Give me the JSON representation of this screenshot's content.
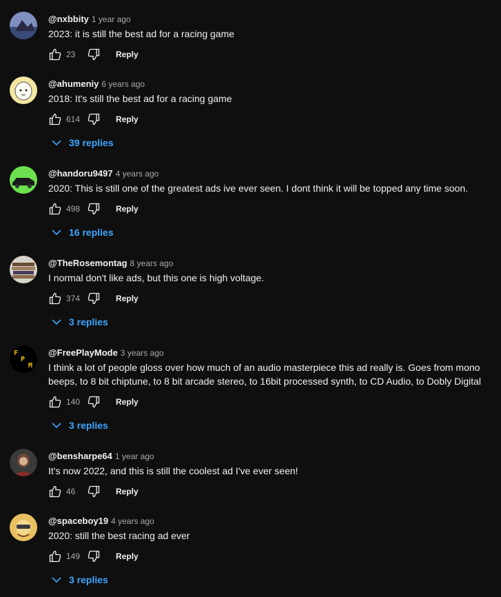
{
  "comments": [
    {
      "author": "@nxbbity",
      "time": "1 year ago",
      "text": "2023: it is still the best ad for a racing game",
      "likes": "23",
      "reply_label": "Reply",
      "replies_label": ""
    },
    {
      "author": "@ahumeniy",
      "time": "6 years ago",
      "text": "2018: It's still the best ad for a racing game",
      "likes": "614",
      "reply_label": "Reply",
      "replies_label": "39 replies"
    },
    {
      "author": "@handoru9497",
      "time": "4 years ago",
      "text": "2020: This is still one of the greatest ads ive ever seen. I dont think it will be topped any time soon.",
      "likes": "498",
      "reply_label": "Reply",
      "replies_label": "16 replies"
    },
    {
      "author": "@TheRosemontag",
      "time": "8 years ago",
      "text": "I normal don't like ads, but this one is high voltage.",
      "likes": "374",
      "reply_label": "Reply",
      "replies_label": "3 replies"
    },
    {
      "author": "@FreePlayMode",
      "time": "3 years ago",
      "text": "I think a lot of people gloss over how much of an audio masterpiece this ad really is. Goes from mono beeps, to 8 bit chiptune, to 8 bit arcade stereo, to 16bit processed synth, to CD Audio, to Dobly Digital",
      "likes": "140",
      "reply_label": "Reply",
      "replies_label": "3 replies",
      "avatar_letters": [
        "F",
        "P",
        "M"
      ]
    },
    {
      "author": "@bensharpe64",
      "time": "1 year ago",
      "text": "It's now 2022, and this is still the coolest ad I've ever seen!",
      "likes": "46",
      "reply_label": "Reply",
      "replies_label": ""
    },
    {
      "author": "@spaceboy19",
      "time": "4 years ago",
      "text": "2020: still the best racing ad ever",
      "likes": "149",
      "reply_label": "Reply",
      "replies_label": "3 replies"
    }
  ],
  "icons": {
    "like": "thumbs-up-icon",
    "dislike": "thumbs-down-icon",
    "expand": "chevron-down-icon"
  },
  "colors": {
    "background": "#0f0f0f",
    "text": "#f1f1f1",
    "secondary": "#aaaaaa",
    "link": "#3ea6ff"
  }
}
